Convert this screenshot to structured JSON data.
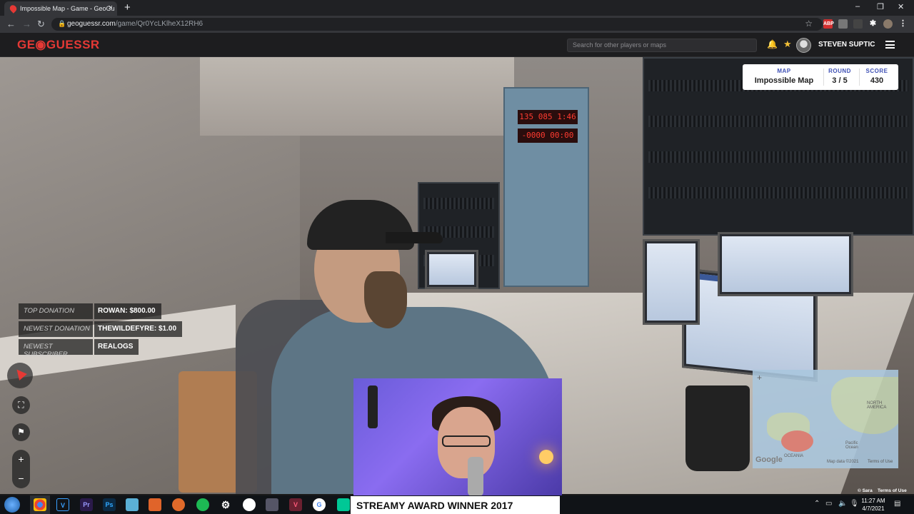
{
  "browser": {
    "tab_title": "Impossible Map - Game - GeoGu",
    "tab_close": "×",
    "new_tab": "+",
    "url_host": "geoguessr.com",
    "url_path": "/game/Qr0YcLKlheX12RH6",
    "window_controls": [
      "–",
      "❐",
      "✕"
    ],
    "extension_abp": "ABP"
  },
  "header": {
    "logo": "GE◉GUESSR",
    "search_placeholder": "Search for other players or maps",
    "username": "STEVEN SUPTIC"
  },
  "hud": {
    "map_label": "MAP",
    "map_value": "Impossible Map",
    "round_label": "ROUND",
    "round_value": "3 / 5",
    "score_label": "SCORE",
    "score_value": "430"
  },
  "overlay": {
    "rows": [
      {
        "label": "TOP DONATION",
        "value": "ROWAN: $800.00"
      },
      {
        "label": "NEWEST DONATION",
        "value": "THEWILDEFYRE: $1.00"
      },
      {
        "label": "NEWEST SUBSCRIBER",
        "value": "REALOGS"
      }
    ]
  },
  "scene": {
    "led_top": "135 085 1:46",
    "led_bottom": "-0000 00:00"
  },
  "minimap": {
    "north_america": "NORTH AMERICA",
    "oceania": "OCEANIA",
    "pacific": "Pacific Ocean",
    "google": "Google",
    "map_data": "Map data ©2021",
    "terms": "Terms of Use",
    "plus": "+"
  },
  "stream": {
    "banner": "STREAMY AWARD WINNER 2017"
  },
  "taskbar": {
    "time": "11:27 AM",
    "date": "4/7/2021",
    "sara": "© Sara",
    "terms": "Terms of Use"
  },
  "controls": {
    "zoom_in": "+",
    "zoom_out": "−"
  },
  "colors": {
    "brand": "#e53935",
    "hud_label": "#3f51b5"
  }
}
